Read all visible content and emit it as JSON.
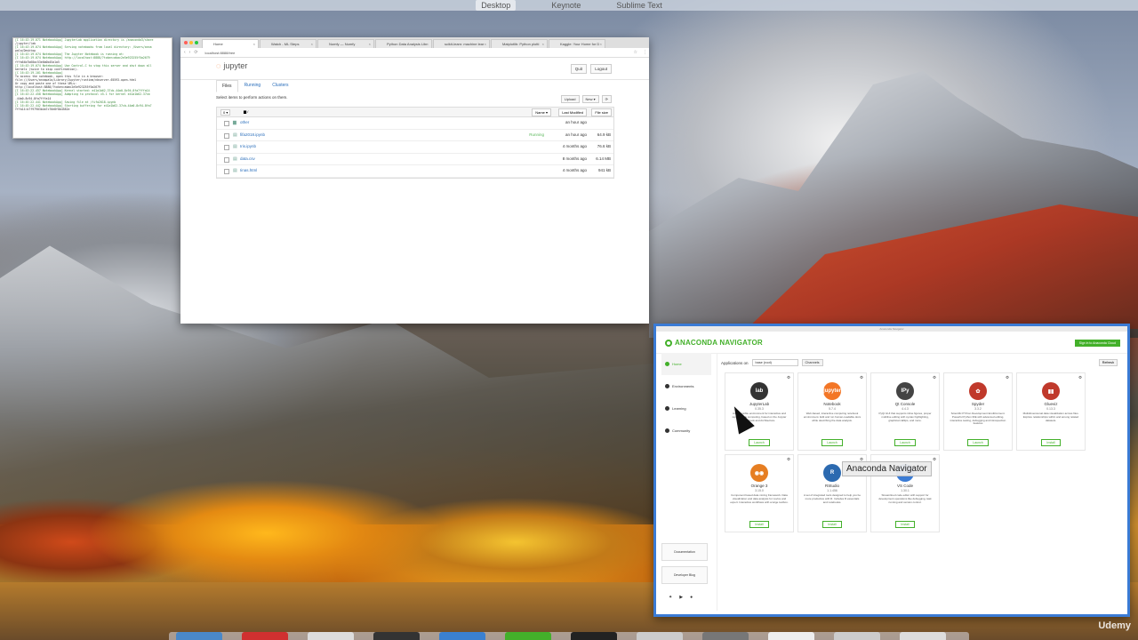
{
  "menubar": {
    "items": [
      "Desktop",
      "Keynote",
      "Sublime Text"
    ]
  },
  "terminal": {
    "lines": [
      "[I 16:43:19.071 NotebookApp] JupyterLab application directory is /anaconda3/share",
      "/jupyter/lab",
      "[I 16:43:19.074 NotebookApp] Serving notebooks from local directory: /Users/anna",
      "pala/Desktop",
      "[I 16:43:19.074 NotebookApp] The Jupyter Notebook is running at:",
      "[I 16:43:19.074 NotebookApp] http://localhost:8888/?token=abac2e5e923255f5a2679",
      "fffa64b7b68ac53e6b0b45a1a5",
      "[I 16:43:19.074 NotebookApp] Use Control-C to stop this server and shut down all",
      " kernels (twice to skip confirmation).",
      "[C 16:43:19.101 NotebookApp]",
      "",
      "    To access the notebook, open this file in a browser:",
      "        file:///Users/annapala/Library/Jupyter/runtime/nbserver-65593-open.html",
      "    Or copy and paste one of these URLs:",
      "        http://localhost:8888/?token=abac2e5e923255f5a2679",
      "[I 16:43:22.457 NotebookApp] Kernel started: e41a1b62-37cb-44a0-8c94-8fa7fffa14",
      "[I 16:43:22.458 NotebookApp] Adapting to protocol v5.1 for kernel e41a1b62-37cb",
      "-44a0-8c94-8fa7fffa14",
      "[I 16:45:22.441 NotebookApp] Saving file at /fifa2018.ipynb",
      "[I 16:45:22.442 NotebookApp] Starting buffering for e41a1b62-37cb-44a0-8c94-8fa7",
      "fffa14:b7f97903b4a7c70e8f0b4582e"
    ]
  },
  "browser": {
    "tabs": [
      "Home",
      "Watch - ML Steps",
      "Numfy — Numfy",
      "Python Data Analysis Libr",
      "scikit-learn: machine lear",
      "Matplotlib: Python plotti",
      "Kaggle: Your Home for D"
    ],
    "url": "localhost:8888/tree",
    "jupyter_logo": "jupyter",
    "quit": "Quit",
    "logout": "Logout",
    "tabs_inner": [
      "Files",
      "Running",
      "Clusters"
    ],
    "hint": "Select items to perform actions on them.",
    "upload": "Upload",
    "new": "New ▾",
    "refresh": "⟳",
    "select_count": "0 ▾",
    "breadcrumb": "/",
    "col_name": "Name ▾",
    "col_modified": "Last Modified",
    "col_size": "File size",
    "files": [
      {
        "name": "other",
        "status": "",
        "modified": "an hour ago",
        "size": ""
      },
      {
        "name": "fifa2018.ipynb",
        "status": "Running",
        "modified": "an hour ago",
        "size": "64.9 kB"
      },
      {
        "name": "Iris.ipynb",
        "status": "",
        "modified": "4 months ago",
        "size": "76.6 kB"
      },
      {
        "name": "data.csv",
        "status": "",
        "modified": "8 months ago",
        "size": "6.14 MB"
      },
      {
        "name": "Iinas.html",
        "status": "",
        "modified": "4 months ago",
        "size": "941 kB"
      }
    ]
  },
  "anaconda": {
    "title": "Anaconda Navigator",
    "logo": "ANACONDA NAVIGATOR",
    "signin": "Sign in to Anaconda Cloud",
    "nav": [
      "Home",
      "Environments",
      "Learning",
      "Community"
    ],
    "sidecards": [
      "Documentation",
      "Developer Blog"
    ],
    "apps_on": "Applications on",
    "env": "base (root)",
    "channels": "Channels",
    "refresh": "Refresh",
    "apps": [
      {
        "name": "JupyterLab",
        "ver": "0.35.3",
        "desc": "An extensible environment for interactive and reproducible computing, based on the Jupyter Notebook and Architecture.",
        "action": "Launch",
        "logo": "lab",
        "color": "#333333"
      },
      {
        "name": "Notebook",
        "ver": "5.7.4",
        "desc": "Web-based, interactive computing notebook environment. Edit and run human-readable docs while describing the data analysis.",
        "action": "Launch",
        "logo": "jupyter",
        "color": "#f37626"
      },
      {
        "name": "Qt Console",
        "ver": "4.4.3",
        "desc": "PyQt GUI that supports inline figures, proper multiline editing with syntax highlighting, graphical calltips, and more.",
        "action": "Launch",
        "logo": "IPy",
        "color": "#444444"
      },
      {
        "name": "Spyder",
        "ver": "3.3.2",
        "desc": "Scientific PYthon Development EnviRonment. Powerful Python IDE with advanced editing, interactive testing, debugging and introspection features",
        "action": "Launch",
        "logo": "✿",
        "color": "#c0392b"
      },
      {
        "name": "Glueviz",
        "ver": "0.13.3",
        "desc": "Multidimensional data visualization across files. Explore relationships within and among related datasets.",
        "action": "Install",
        "logo": "▮▮",
        "color": "#c0392b"
      },
      {
        "name": "Orange 3",
        "ver": "3.15.0",
        "desc": "Component based data mining framework. Data visualization and data analysis for novice and expert. Interactive workflows with a large toolbox.",
        "action": "Install",
        "logo": "◉◉",
        "color": "#e67e22"
      },
      {
        "name": "RStudio",
        "ver": "1.1.456",
        "desc": "A set of integrated tools designed to help you be more productive with R. Includes R essentials and notebooks.",
        "action": "Install",
        "logo": "R",
        "color": "#2c6ab0"
      },
      {
        "name": "VS Code",
        "ver": "1.30.1",
        "desc": "Streamlined code editor with support for development operations like debugging, task running and version control.",
        "action": "Install",
        "logo": "",
        "color": "#3a7bd5"
      }
    ],
    "tooltip": "Anaconda Navigator"
  },
  "udemy": "Udemy",
  "dock_colors": [
    "#4a88c8",
    "#d03030",
    "#dddddd",
    "#333333",
    "#3a80d0",
    "#43b02a",
    "#222222",
    "#cccccc",
    "#777777",
    "#eeeeee",
    "#cccccc",
    "#dddddd"
  ]
}
